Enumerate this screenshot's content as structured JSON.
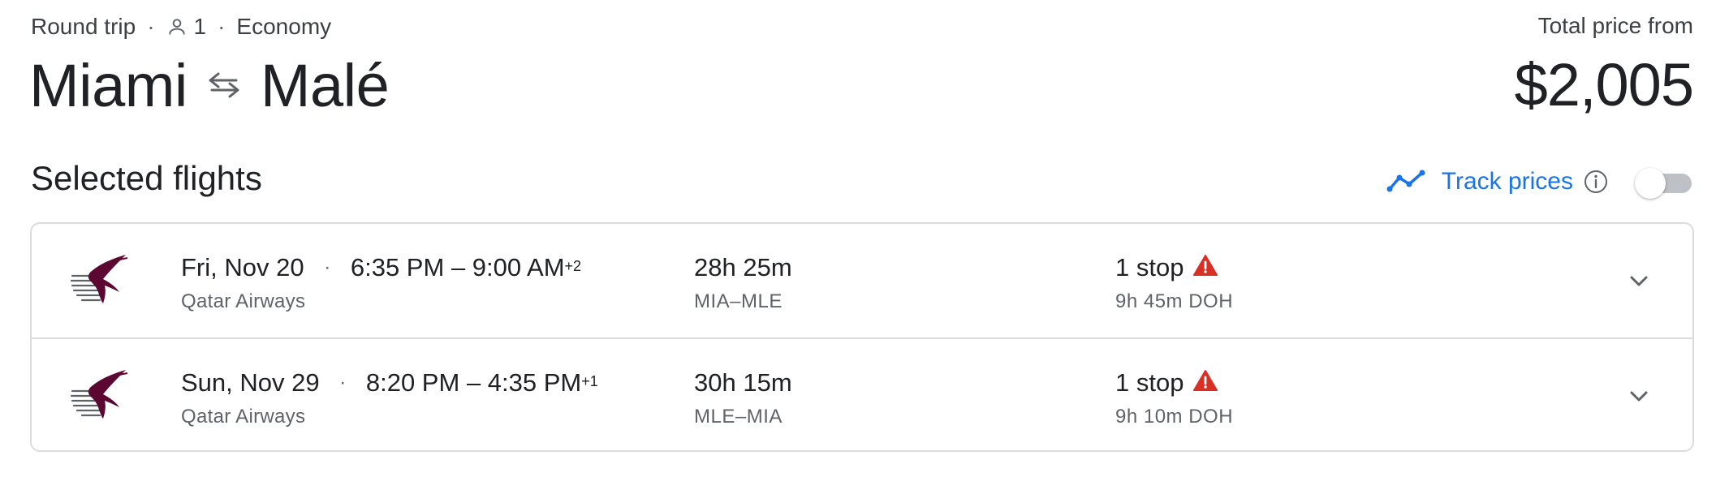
{
  "trip": {
    "type": "Round trip",
    "passengers": "1",
    "cabin": "Economy",
    "origin": "Miami",
    "destination": "Malé"
  },
  "price": {
    "label": "Total price from",
    "value": "$2,005"
  },
  "selected_flights": {
    "title": "Selected flights",
    "track_prices_label": "Track prices",
    "track_prices_enabled": false
  },
  "flights": [
    {
      "date": "Fri, Nov 20",
      "depart": "6:35 PM",
      "arrive": "9:00 AM",
      "day_offset": "+2",
      "airline": "Qatar Airways",
      "duration": "28h 25m",
      "route": "MIA–MLE",
      "stops": "1 stop",
      "layover": "9h 45m DOH"
    },
    {
      "date": "Sun, Nov 29",
      "depart": "8:20 PM",
      "arrive": "4:35 PM",
      "day_offset": "+1",
      "airline": "Qatar Airways",
      "duration": "30h 15m",
      "route": "MLE–MIA",
      "stops": "1 stop",
      "layover": "9h 10m DOH"
    }
  ],
  "colors": {
    "accent": "#1a73e8",
    "warning": "#d93025",
    "airline_brand": "#5c0632",
    "border": "#dadce0",
    "secondary_text": "#5f6368"
  },
  "icons": {
    "passenger": "person-icon",
    "swap": "swap-arrows-icon",
    "track": "trend-line-icon",
    "info": "info-icon",
    "warning": "warning-icon",
    "expand": "chevron-down-icon",
    "airline": "qatar-airways-logo"
  }
}
